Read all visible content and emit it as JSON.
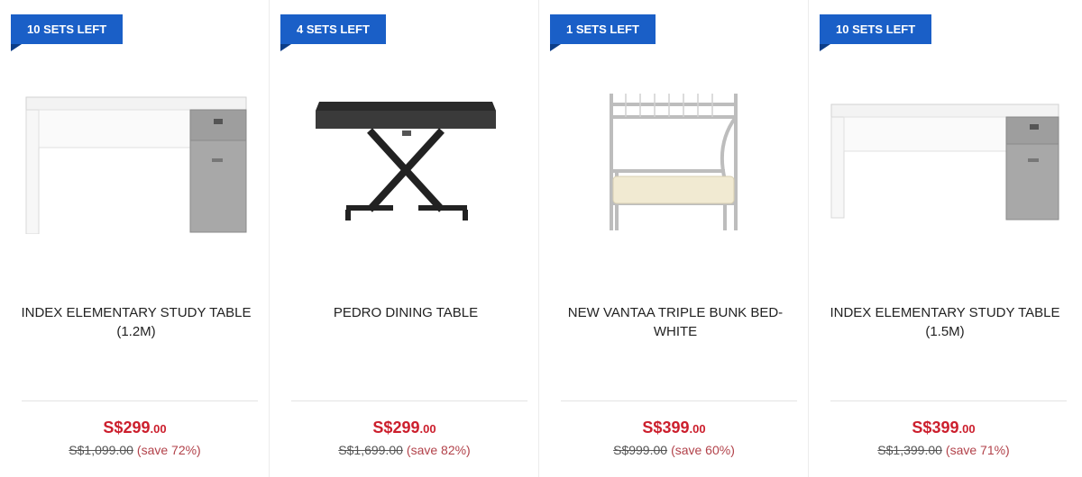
{
  "products": [
    {
      "badge": "10 SETS LEFT",
      "name_line1": "INDEX ELEMENTARY STUDY TABLE",
      "name_line2": "(1.2M)",
      "price_main": "S$299",
      "price_cents": ".00",
      "old_price": "S$1,099.00",
      "save": "(save 72%)",
      "image_icon": "study-table-image"
    },
    {
      "badge": "4 SETS LEFT",
      "name_line1": "PEDRO DINING TABLE",
      "name_line2": "",
      "price_main": "S$299",
      "price_cents": ".00",
      "old_price": "S$1,699.00",
      "save": "(save 82%)",
      "image_icon": "dining-table-image"
    },
    {
      "badge": "1 SETS LEFT",
      "name_line1": "NEW VANTAA TRIPLE BUNK BED-",
      "name_line2": "WHITE",
      "price_main": "S$399",
      "price_cents": ".00",
      "old_price": "S$999.00",
      "save": "(save 60%)",
      "image_icon": "bunk-bed-image"
    },
    {
      "badge": "10 SETS LEFT",
      "name_line1": "INDEX ELEMENTARY STUDY TABLE",
      "name_line2": "(1.5M)",
      "price_main": "S$399",
      "price_cents": ".00",
      "old_price": "S$1,399.00",
      "save": "(save 71%)",
      "image_icon": "study-table-image"
    }
  ],
  "colors": {
    "badge": "#1a5fc7",
    "price": "#cc1f2d",
    "save": "#b2424a"
  }
}
